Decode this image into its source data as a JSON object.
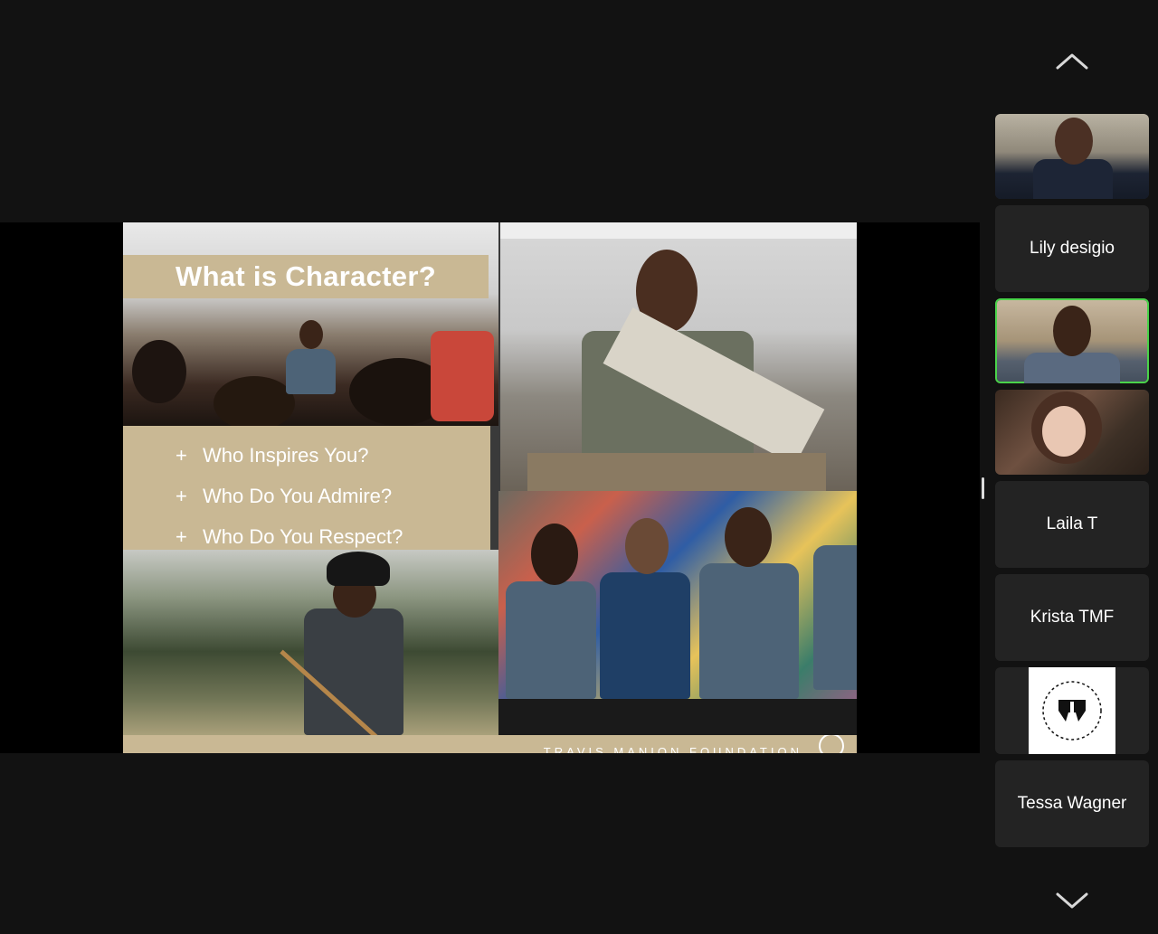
{
  "slide": {
    "title": "What is Character?",
    "questions": [
      "Who Inspires You?",
      "Who Do You Admire?",
      "Who Do You Respect?"
    ],
    "footer_text": "TRAVIS MANION FOUNDATION"
  },
  "participants": [
    {
      "type": "video",
      "icon": "participant-video"
    },
    {
      "type": "name",
      "name": "Lily desigio"
    },
    {
      "type": "video",
      "icon": "participant-video",
      "active_speaker": true
    },
    {
      "type": "video",
      "icon": "participant-video"
    },
    {
      "type": "name",
      "name": "Laila T"
    },
    {
      "type": "name",
      "name": "Krista TMF"
    },
    {
      "type": "logo",
      "icon": "travis-manion-foundation-logo"
    },
    {
      "type": "name",
      "name": "Tessa Wagner"
    }
  ],
  "colors": {
    "background": "#121212",
    "tile": "#232323",
    "active_speaker": "#4ad34a",
    "slide_accent": "#c9b894"
  },
  "icons": {
    "scroll_up": "chevron-up-icon",
    "scroll_down": "chevron-down-icon"
  }
}
